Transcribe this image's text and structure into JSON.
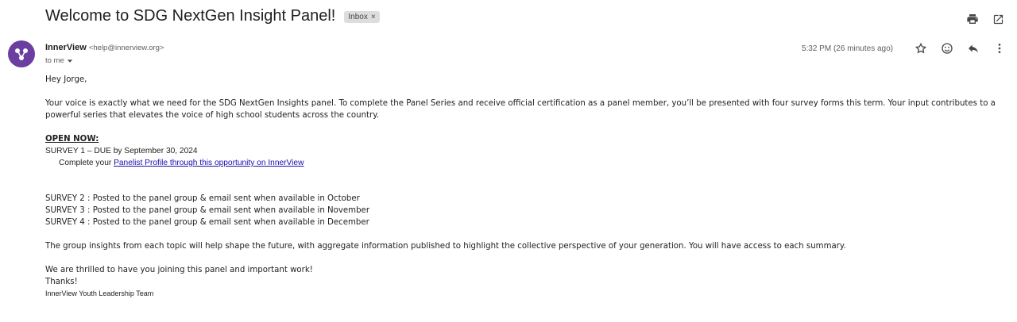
{
  "subject": "Welcome to SDG NextGen Insight Panel!",
  "label_chip": {
    "text": "Inbox",
    "close": "×"
  },
  "sender": {
    "name": "InnerView",
    "email": "<help@innerview.org>",
    "to": "to me",
    "time": "5:32 PM (26 minutes ago)"
  },
  "icons": {
    "print": "print-icon",
    "open_new": "open-in-new-window-icon",
    "star": "star-icon",
    "emoji": "emoji-icon",
    "reply": "reply-icon",
    "more": "more-vertical-icon",
    "avatar": "innerview-logo"
  },
  "colors": {
    "avatar_bg": "#6a3fa0",
    "link": "#1a0dab"
  },
  "body": {
    "greeting": "Hey Jorge,",
    "para1": "Your voice is exactly what we need for the SDG NextGen Insights panel.  To complete the Panel Series and receive official certification as a panel member, you’ll be presented with four survey forms this term.  Your input contributes to a powerful series that elevates the voice of high school students across the country.",
    "open_now": "OPEN NOW:",
    "survey1": "SURVEY 1 – DUE by September 30, 2024",
    "survey1_prefix": "Complete your ",
    "survey1_link": "Panelist Profile through this opportunity on InnerView",
    "survey2": "SURVEY 2 : Posted to the panel group & email sent when available in October",
    "survey3": "SURVEY 3 : Posted to the panel group & email sent when available in November",
    "survey4": "SURVEY 4 : Posted to the panel group & email sent when available in December",
    "para2": "The group insights from each topic will help shape the future, with aggregate information published to highlight the collective perspective of your generation.  You will have access to each summary.",
    "thrilled": "We are thrilled to have you joining this panel and important work!",
    "thanks": "Thanks!",
    "signature": "InnerView Youth Leadership Team"
  }
}
